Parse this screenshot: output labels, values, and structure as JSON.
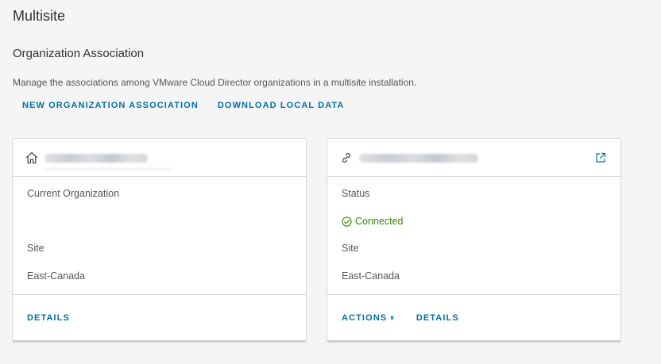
{
  "page": {
    "title": "Multisite",
    "section_title": "Organization Association",
    "description": "Manage the associations among VMware Cloud Director organizations in a multisite installation."
  },
  "toolbar": {
    "new_label": "NEW ORGANIZATION ASSOCIATION",
    "download_label": "DOWNLOAD LOCAL DATA"
  },
  "cards": [
    {
      "header_icon": "home-icon",
      "name_redacted": true,
      "role_label": "Current Organization",
      "site_label": "Site",
      "site_value": "East-Canada",
      "details_label": "DETAILS"
    },
    {
      "header_icon": "link-icon",
      "name_redacted": true,
      "status_label": "Status",
      "status_value": "Connected",
      "status_color": "#318700",
      "site_label": "Site",
      "site_value": "East-Canada",
      "actions_label": "ACTIONS",
      "details_label": "DETAILS",
      "external_icon": "external-link-icon"
    }
  ],
  "colors": {
    "accent": "#0072a3",
    "background": "#f5f5f5",
    "card_border": "#d7d7d7"
  }
}
